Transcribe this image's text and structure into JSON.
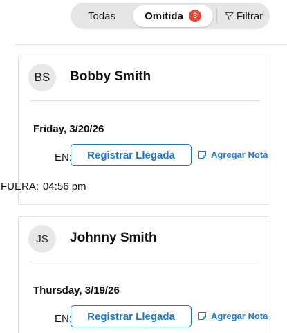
{
  "filter_bar": {
    "tabs": [
      {
        "label": "Todas"
      },
      {
        "label": "Omitida",
        "badge": "3",
        "selected": true
      }
    ],
    "filter_label": "Filtrar"
  },
  "colors": {
    "accent": "#1f77c7",
    "badge": "#e04a37",
    "segment_bg": "#e6e6e6"
  },
  "cards": [
    {
      "initials": "BS",
      "name": "Bobby Smith",
      "date": "Friday,  3/20/26",
      "in_label": "EN:",
      "checkin_button": "Registrar Llegada",
      "add_note": "Agregar Nota",
      "out_label": "FUERA:",
      "out_time": "04:56 pm"
    },
    {
      "initials": "JS",
      "name": "Johnny Smith",
      "date": "Thursday,  3/19/26",
      "in_label": "EN:",
      "checkin_button": "Registrar Llegada",
      "add_note": "Agregar Nota"
    }
  ]
}
